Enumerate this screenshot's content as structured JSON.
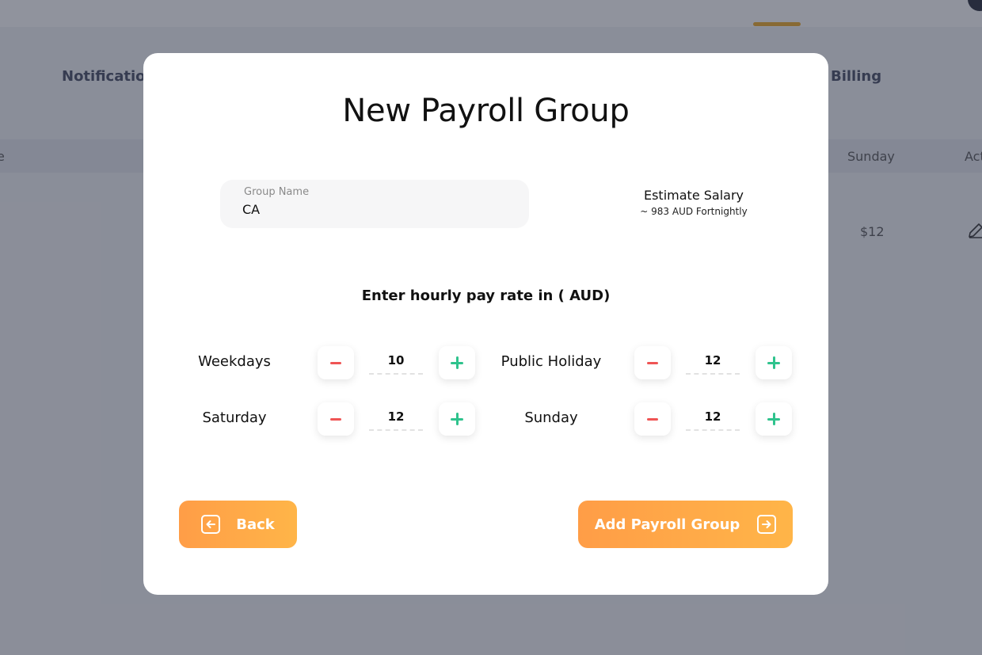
{
  "background": {
    "tabs": {
      "notifications": "Notification",
      "billing": "Billing"
    },
    "table": {
      "headers": {
        "first_partial": "e",
        "sunday": "Sunday",
        "actions_partial": "Act"
      },
      "row": {
        "sunday_value": "$12"
      }
    }
  },
  "modal": {
    "title": "New Payroll Group",
    "group_name": {
      "label": "Group Name",
      "value": "CA"
    },
    "estimate": {
      "title": "Estimate Salary",
      "value": "~ 983 AUD Fortnightly"
    },
    "rate_heading": "Enter hourly pay rate in ( AUD)",
    "rates": {
      "weekdays": {
        "label": "Weekdays",
        "value": "10"
      },
      "public_holiday": {
        "label": "Public Holiday",
        "value": "12"
      },
      "saturday": {
        "label": "Saturday",
        "value": "12"
      },
      "sunday": {
        "label": "Sunday",
        "value": "12"
      }
    },
    "buttons": {
      "back": "Back",
      "add": "Add Payroll Group"
    }
  },
  "colors": {
    "accent_orange": "#ff9d47",
    "minus_red": "#ef5454",
    "plus_green": "#2fc38d"
  },
  "icons": [
    "arrow-left-box-icon",
    "arrow-right-box-icon",
    "minus-icon",
    "plus-icon",
    "edit-pencil-icon"
  ]
}
